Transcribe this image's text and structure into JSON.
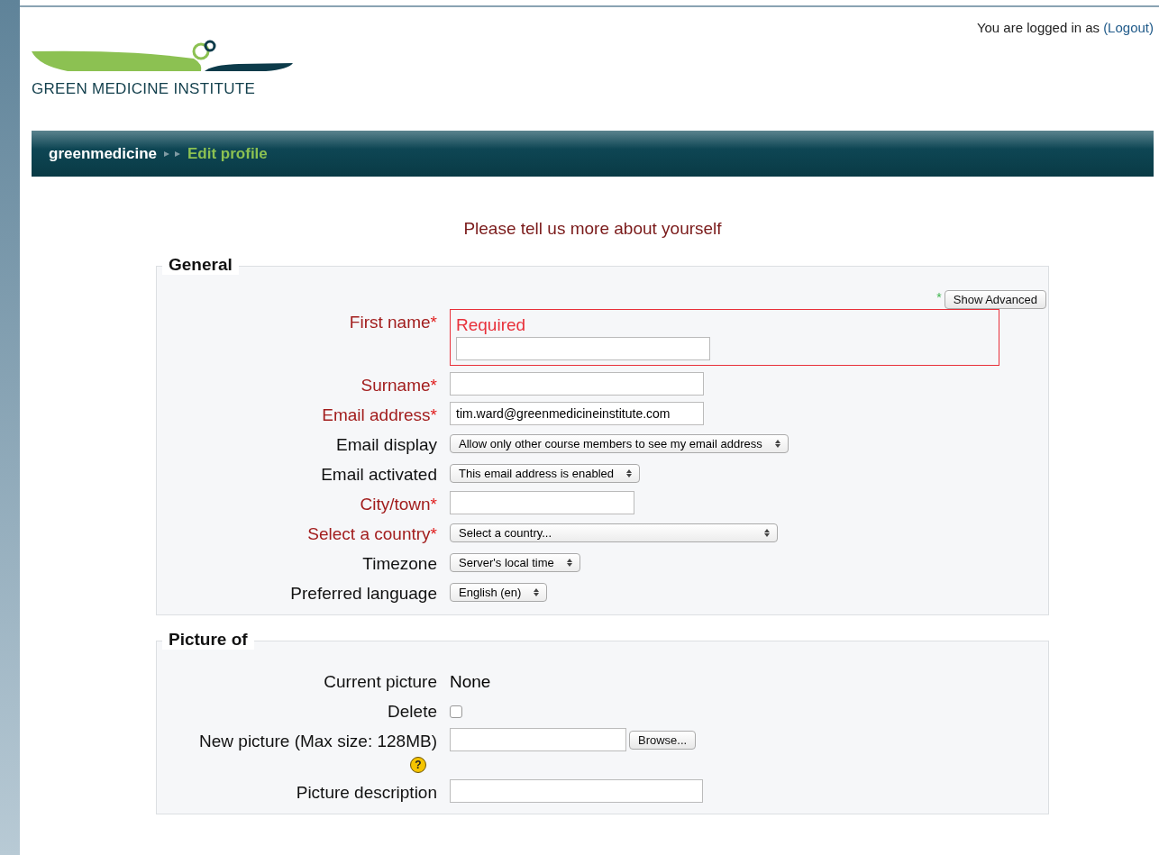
{
  "header": {
    "logo_text": "GREEN MEDICINE INSTITUTE",
    "login_text": "You are logged in as",
    "logout_link": "(Logout)"
  },
  "breadcrumb": [
    {
      "label": "greenmedicine",
      "current": false
    },
    {
      "label": "Edit profile",
      "current": true
    }
  ],
  "heading": "Please tell us more about yourself",
  "sections": [
    {
      "legend": "General",
      "advanced_marker": "*",
      "advanced_button": "Show Advanced",
      "rows": [
        {
          "kind": "text",
          "label": "First name",
          "required": true,
          "error": "Required",
          "value": ""
        },
        {
          "kind": "text",
          "label": "Surname",
          "required": true,
          "value": ""
        },
        {
          "kind": "text",
          "label": "Email address",
          "required": true,
          "value": "tim.ward@greenmedicineinstitute.com"
        },
        {
          "kind": "select",
          "label": "Email display",
          "required": false,
          "value": "Allow only other course members to see my email address"
        },
        {
          "kind": "select",
          "label": "Email activated",
          "required": false,
          "value": "This email address is enabled"
        },
        {
          "kind": "text",
          "label": "City/town",
          "required": true,
          "value": ""
        },
        {
          "kind": "select",
          "label": "Select a country",
          "required": true,
          "value": "Select a country..."
        },
        {
          "kind": "select",
          "label": "Timezone",
          "required": false,
          "value": "Server's local time"
        },
        {
          "kind": "select",
          "label": "Preferred language",
          "required": false,
          "value": "English (en)"
        }
      ]
    },
    {
      "legend": "Picture of",
      "rows": [
        {
          "kind": "static",
          "label": "Current picture",
          "value": "None"
        },
        {
          "kind": "checkbox",
          "label": "Delete",
          "checked": false
        },
        {
          "kind": "file",
          "label": "New picture (Max size: 128MB)",
          "button": "Browse...",
          "help": "?"
        },
        {
          "kind": "text",
          "label": "Picture description",
          "required": false,
          "value": ""
        }
      ]
    }
  ]
}
